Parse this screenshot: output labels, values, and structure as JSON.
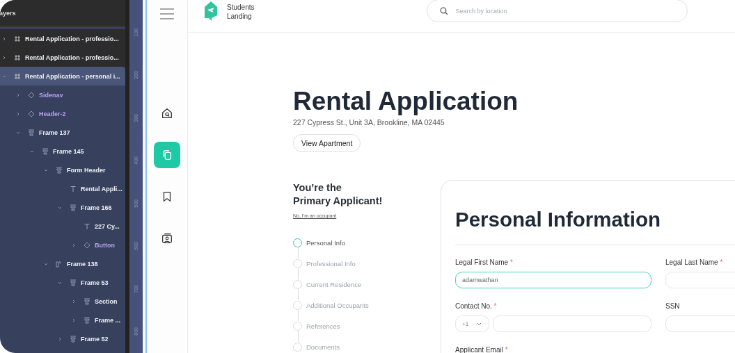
{
  "layers_panel": {
    "title": "ayers",
    "items": [
      {
        "name": "Rental Application - professio...",
        "kind": "frame",
        "expanded": false,
        "selected": false
      },
      {
        "name": "Rental Application - professio...",
        "kind": "frame",
        "expanded": false,
        "selected": false
      },
      {
        "name": "Rental Application - personal i...",
        "kind": "frame",
        "expanded": true,
        "selected": true,
        "children": [
          {
            "name": "Sidenav",
            "kind": "component",
            "expanded": false,
            "selected": false
          },
          {
            "name": "Header-2",
            "kind": "component",
            "expanded": false,
            "selected": false
          },
          {
            "name": "Frame 137",
            "kind": "stack",
            "expanded": true,
            "selected": false,
            "children": [
              {
                "name": "Frame 145",
                "kind": "stack",
                "expanded": true,
                "selected": false,
                "children": [
                  {
                    "name": "Form Header",
                    "kind": "stack",
                    "expanded": true,
                    "selected": false,
                    "children": [
                      {
                        "name": "Rental Appli...",
                        "kind": "text",
                        "selected": false
                      },
                      {
                        "name": "Frame 166",
                        "kind": "stack",
                        "expanded": true,
                        "selected": false,
                        "children": [
                          {
                            "name": "227 Cy...",
                            "kind": "text",
                            "selected": false
                          },
                          {
                            "name": "Button",
                            "kind": "component",
                            "expanded": false,
                            "selected": false
                          }
                        ]
                      }
                    ]
                  },
                  {
                    "name": "Frame 138",
                    "kind": "row",
                    "expanded": true,
                    "selected": false,
                    "children": [
                      {
                        "name": "Frame 53",
                        "kind": "stack",
                        "expanded": true,
                        "selected": false,
                        "children": [
                          {
                            "name": "Section",
                            "kind": "stack",
                            "expanded": false,
                            "selected": false
                          },
                          {
                            "name": "Frame ...",
                            "kind": "stack",
                            "expanded": false,
                            "selected": false
                          }
                        ]
                      },
                      {
                        "name": "Frame 52",
                        "kind": "stack",
                        "expanded": false,
                        "selected": false
                      }
                    ]
                  }
                ]
              }
            ]
          }
        ]
      }
    ]
  },
  "ruler": {
    "marks": [
      "100",
      "200",
      "300",
      "400",
      "500",
      "600",
      "700",
      "800"
    ]
  },
  "sidenav": {
    "items": [
      {
        "kind": "home",
        "selected": false
      },
      {
        "kind": "copy",
        "selected": true
      },
      {
        "kind": "bookmark",
        "selected": false
      },
      {
        "kind": "profile",
        "selected": false
      }
    ]
  },
  "header": {
    "brand_line_1": "Students",
    "brand_line_2": "Landing",
    "search": {
      "placeholder": "Search by location"
    }
  },
  "page": {
    "title": "Rental Application",
    "address": "227 Cypress St., Unit 3A, Brookline, MA 02445",
    "button": "View Apartment"
  },
  "applicant": {
    "heading_line_1": "You’re the",
    "heading_line_2": "Primary Applicant!",
    "link": "No, I’m an occupant",
    "steps": [
      {
        "label": "Personal Info",
        "selected": true
      },
      {
        "label": "Professional Info",
        "selected": false
      },
      {
        "label": "Current Residence",
        "selected": false
      },
      {
        "label": "Additional Occupants",
        "selected": false
      },
      {
        "label": "References",
        "selected": false
      },
      {
        "label": "Documents",
        "selected": false
      }
    ]
  },
  "form": {
    "title": "Personal Information",
    "fields": [
      {
        "kind": "text",
        "label": "Legal First Name",
        "mark": "*",
        "value": "adamwathan",
        "focused": true
      },
      {
        "kind": "text",
        "label": "Legal Last Name",
        "mark": "*",
        "focused": false
      },
      {
        "kind": "phone",
        "label": "Contact No.",
        "mark": "*",
        "country_code": "+1",
        "focused": false
      },
      {
        "kind": "text",
        "label": "SSN",
        "focused": false
      },
      {
        "kind": "label",
        "label": "Applicant Email",
        "mark": "*"
      }
    ]
  }
}
